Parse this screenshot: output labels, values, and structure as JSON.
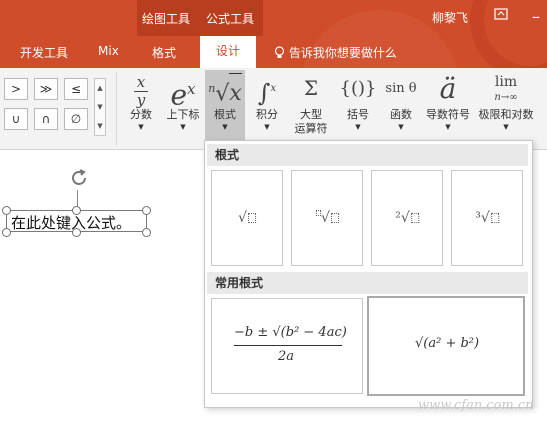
{
  "titlebar": {
    "context_tabs": [
      "绘图工具",
      "公式工具"
    ],
    "user_name": "柳黎飞"
  },
  "tabs": {
    "dev": "开发工具",
    "mix": "Mix",
    "format": "格式",
    "design": "设计",
    "tell_me": "告诉我你想要做什么"
  },
  "symbols": {
    "row1": [
      ">",
      "≫",
      "≤"
    ],
    "row2": [
      "∪",
      "∩",
      "∅"
    ]
  },
  "ribbon": {
    "fraction": {
      "glyph": "x/y",
      "label": "分数"
    },
    "script": {
      "glyph": "eˣ",
      "label": "上下标"
    },
    "radical": {
      "glyph": "ⁿ√x",
      "label": "根式"
    },
    "integral": {
      "glyph": "∫ˣ₋ₓ",
      "label": "积分"
    },
    "large_operator": {
      "glyph": "Σ",
      "label1": "大型",
      "label2": "运算符"
    },
    "bracket": {
      "glyph": "{()}",
      "label": "括号"
    },
    "function": {
      "glyph": "sin θ",
      "label": "函数"
    },
    "accent": {
      "glyph": "ä",
      "label": "导数符号"
    },
    "limit": {
      "glyph": "lim",
      "sub": "n→∞",
      "label": "极限和对数"
    }
  },
  "slide": {
    "placeholder": "在此处键入公式。"
  },
  "gallery": {
    "section_radicals": "根式",
    "section_common": "常用根式",
    "radicals": [
      "√",
      "√",
      "²√",
      "³√"
    ],
    "common": {
      "quadratic_numerator": "−b ± √(b² − 4ac)",
      "quadratic_denominator": "2a",
      "pythagoras": "√(a² + b²)"
    }
  },
  "watermark": "www.cfan.com.cn",
  "colors": {
    "accent": "#cf4d2b",
    "ribbon_bg": "#f3f3f3",
    "selected_button": "#c7c7c7"
  }
}
